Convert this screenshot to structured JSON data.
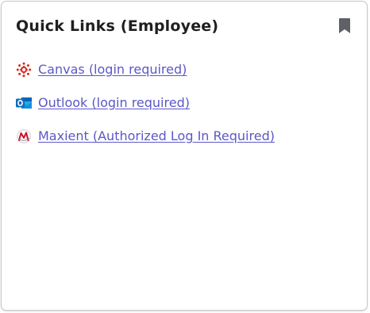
{
  "widget": {
    "title": "Quick Links (Employee)",
    "bookmark_icon": "bookmark-icon",
    "link_color": "#5b57c8",
    "links": [
      {
        "label": "Canvas (login required)",
        "icon": "canvas-icon",
        "icon_color": "#e1251b"
      },
      {
        "label": "Outlook (login required)",
        "icon": "outlook-icon",
        "icon_color": "#0f6cbd"
      },
      {
        "label": "Maxient (Authorized Log In Required)",
        "icon": "maxient-icon",
        "icon_color": "#c8102e"
      }
    ]
  }
}
